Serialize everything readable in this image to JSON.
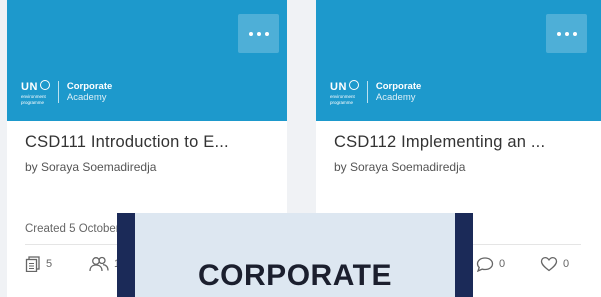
{
  "cards": [
    {
      "logo": {
        "un": "UN",
        "sub1": "environment",
        "sub2": "programme",
        "academy_line1": "Corporate",
        "academy_line2": "Academy"
      },
      "title": "CSD111 Introduction to E...",
      "author": "by Soraya Soemadiredja",
      "created": "Created 5 October",
      "stats": {
        "documents": "5",
        "users": "12"
      }
    },
    {
      "logo": {
        "un": "UN",
        "sub1": "environment",
        "sub2": "programme",
        "academy_line1": "Corporate",
        "academy_line2": "Academy"
      },
      "title": "CSD112 Implementing an ...",
      "author": "by Soraya Soemadiredja",
      "stats": {
        "comments": "0",
        "likes": "0"
      }
    }
  ],
  "overlay": {
    "text": "CORPORATE"
  },
  "colors": {
    "banner": "#1d99cc",
    "overlay_border": "#1b2a58",
    "overlay_bg": "#dde7f1"
  }
}
